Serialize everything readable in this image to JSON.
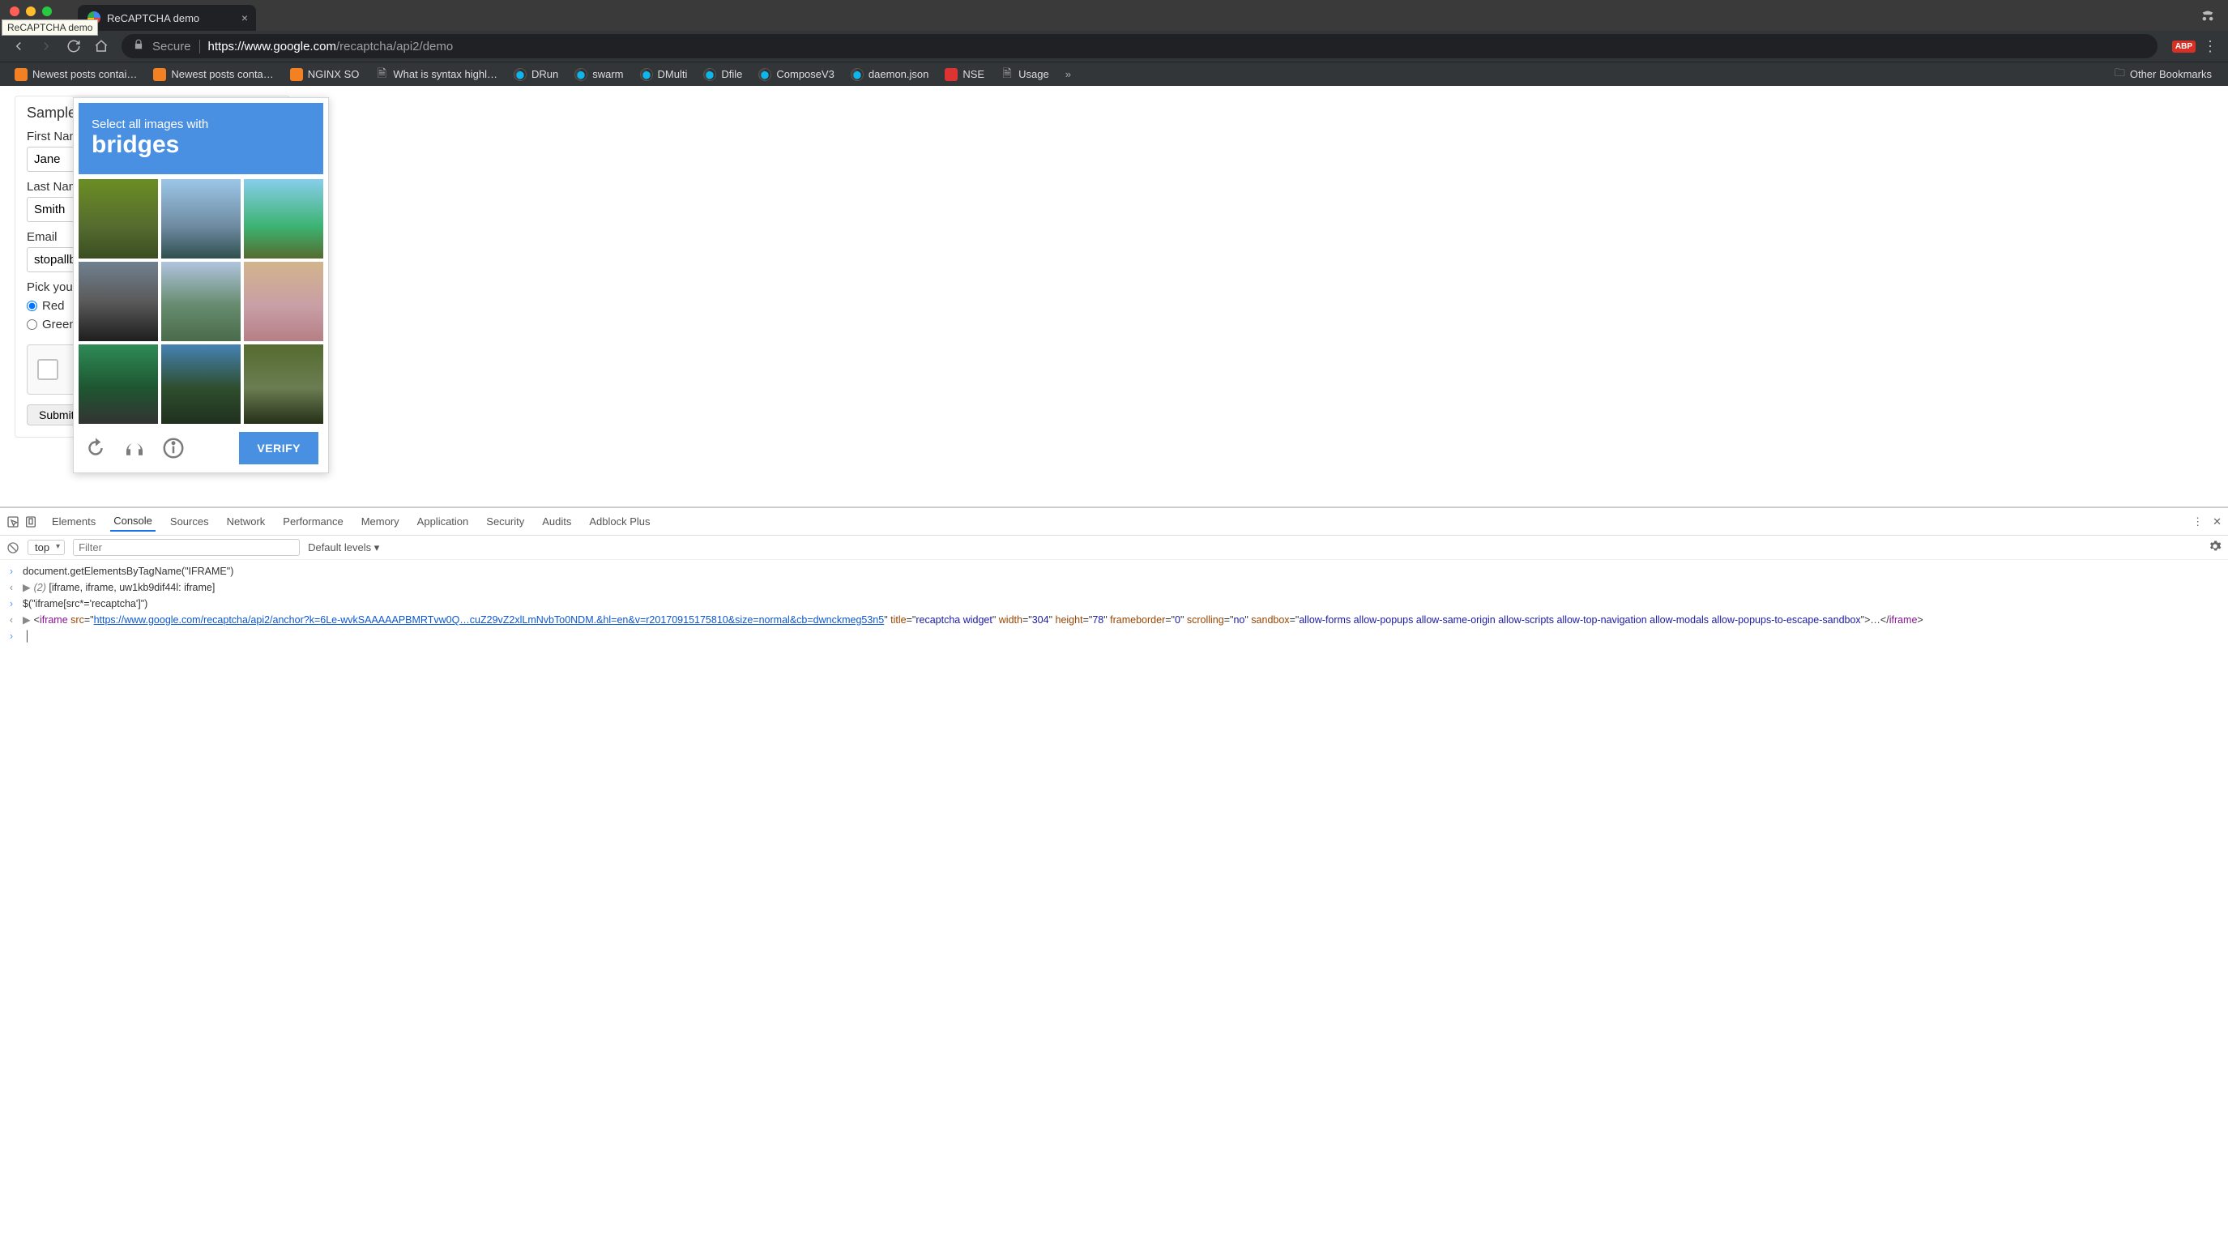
{
  "window": {
    "tab_title": "ReCAPTCHA demo",
    "tooltip": "ReCAPTCHA demo"
  },
  "toolbar": {
    "secure_label": "Secure",
    "url_host": "https://www.google.com",
    "url_path": "/recaptcha/api2/demo",
    "ext_badge": "ABP"
  },
  "bookmarks": {
    "items": [
      "Newest posts contai…",
      "Newest posts conta…",
      "NGINX SO",
      "What is syntax highl…",
      "DRun",
      "swarm",
      "DMulti",
      "Dfile",
      "ComposeV3",
      "daemon.json",
      "NSE",
      "Usage"
    ],
    "overflow": "»",
    "other": "Other Bookmarks"
  },
  "form": {
    "heading": "Sample",
    "first_name_label": "First Name",
    "first_name_value": "Jane",
    "last_name_label": "Last Name",
    "last_name_value": "Smith",
    "email_label": "Email",
    "email_value": "stopallb",
    "pick_label": "Pick your",
    "radio_red": "Red",
    "radio_green": "Green",
    "submit": "Submit"
  },
  "recaptcha": {
    "line1": "Select all images with",
    "subject": "bridges",
    "verify": "VERIFY"
  },
  "devtools": {
    "tabs": [
      "Elements",
      "Console",
      "Sources",
      "Network",
      "Performance",
      "Memory",
      "Application",
      "Security",
      "Audits",
      "Adblock Plus"
    ],
    "active_tab": "Console",
    "scope": "top",
    "filter_placeholder": "Filter",
    "levels": "Default levels ▾",
    "lines": {
      "l1": "document.getElementsByTagName(\"IFRAME\")",
      "l2_pre": "(2) ",
      "l2_body": "[iframe, iframe, uw1kb9dif44l: iframe]",
      "l3": "$(\"iframe[src*='recaptcha']\")",
      "l4_url": "https://www.google.com/recaptcha/api2/anchor?k=6Le-wvkSAAAAAPBMRTvw0Q…cuZ29vZ2xlLmNvbTo0NDM.&hl=en&v=r20170915175810&size=normal&cb=dwnckmeg53n5",
      "l4_title": "recaptcha widget",
      "l4_width": "304",
      "l4_height": "78",
      "l4_fb": "0",
      "l4_scroll": "no",
      "l4_sandbox": "allow-forms allow-popups allow-same-origin allow-scripts allow-top-navigation allow-modals allow-popups-to-escape-sandbox"
    }
  }
}
